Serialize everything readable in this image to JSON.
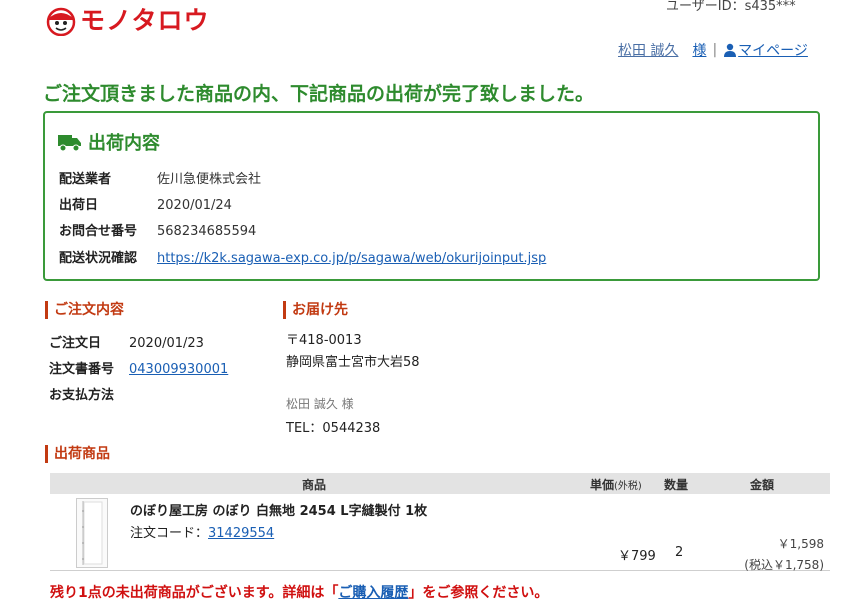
{
  "header": {
    "logo_text": "モノタロウ",
    "user_id_text": "ユーザーID：s435***",
    "user_name": "松田 誠久",
    "honorific": "様",
    "separator": "|",
    "mypage_label": "マイページ"
  },
  "headline": "ご注文頂きました商品の内、下記商品の出荷が完了致しました。",
  "shipping": {
    "title": "出荷内容",
    "rows": [
      {
        "label": "配送業者",
        "value": "佐川急便株式会社"
      },
      {
        "label": "出荷日",
        "value": "2020/01/24"
      },
      {
        "label": "お問合せ番号",
        "value": "568234685594"
      },
      {
        "label": "配送状況確認",
        "value": "https://k2k.sagawa-exp.co.jp/p/sagawa/web/okurijoinput.jsp"
      }
    ]
  },
  "order": {
    "title": "ご注文内容",
    "date_label": "ご注文日",
    "date_value": "2020/01/23",
    "number_label": "注文書番号",
    "number_value": "043009930001",
    "payment_label": "お支払方法"
  },
  "delivery": {
    "title": "お届け先",
    "postal": "〒418-0013",
    "address": "静岡県富士宮市大岩58",
    "name": "松田 誠久 様",
    "tel": "TEL：0544238"
  },
  "products": {
    "title": "出荷商品",
    "headers": {
      "item": "商品",
      "unit_price": "単価",
      "unit_price_note": "(外税)",
      "qty": "数量",
      "amount": "金額"
    },
    "rows": [
      {
        "name": "のぼり屋工房 のぼり 白無地 2454 L字縫製付 1枚",
        "code_label": "注文コード：",
        "code": "31429554",
        "unit_price": "￥799",
        "qty": "2",
        "amount": "￥1,598",
        "amount_tax": "(税込￥1,758)"
      }
    ]
  },
  "notice": {
    "before": "残り1点の未出荷商品がございます。詳細は「",
    "link": "ご購入履歴",
    "after": "」をご参照ください。"
  },
  "colors": {
    "brand_red": "#d71920",
    "green": "#2e8b2e",
    "section_orange": "#c23a12",
    "link_blue": "#1a5fb4",
    "notice_red": "#d01010"
  }
}
